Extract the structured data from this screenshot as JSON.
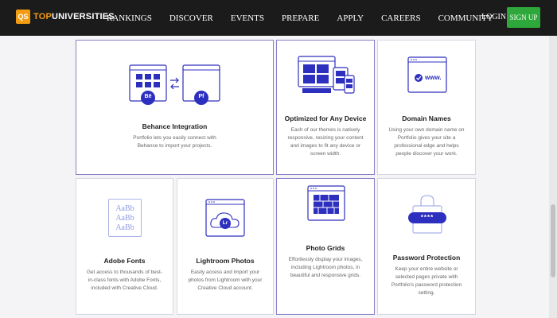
{
  "brand": {
    "badge": "QS",
    "name_prefix": "TOP",
    "name_suffix": "UNIVERSITIES"
  },
  "nav": {
    "links": [
      "RANKINGS",
      "DISCOVER",
      "EVENTS",
      "PREPARE",
      "APPLY",
      "CAREERS",
      "COMMUNITY"
    ],
    "login": "LOGIN",
    "signup": "SIGN UP"
  },
  "colors": {
    "accent": "#2d2fbf",
    "signup": "#2ea83a",
    "brand_orange": "#f39c12",
    "nav_bg": "#1b1b1b"
  },
  "features": {
    "behance": {
      "title": "Behance Integration",
      "desc": "Portfolio lets you easily connect with Behance to import your projects.",
      "icon_left": "Bē",
      "icon_right": "Pf"
    },
    "device": {
      "title": "Optimized for Any Device",
      "desc": "Each of our themes is natively responsive, resizing your content and images to fit any device or screen width."
    },
    "domain": {
      "title": "Domain Names",
      "desc": "Using your own domain name on Portfolio gives your site a professional edge and helps people discover your work.",
      "url_text": "www."
    },
    "fonts": {
      "title": "Adobe Fonts",
      "desc": "Get access to thousands of best-in-class fonts with Adobe Fonts, included with Creative Cloud.",
      "sample": "AaBb"
    },
    "lightroom": {
      "title": "Lightroom Photos",
      "desc": "Easily access and import your photos from Lightroom with your Creative Cloud account.",
      "icon": "Lr"
    },
    "grids": {
      "title": "Photo Grids",
      "desc": "Effortlessly display your images, including Lightroom photos, in beautiful and responsive grids."
    },
    "password": {
      "title": "Password Protection",
      "desc": "Keep your entire website or selected pages private with Portfolio's password protection setting.",
      "mask": "****"
    }
  }
}
